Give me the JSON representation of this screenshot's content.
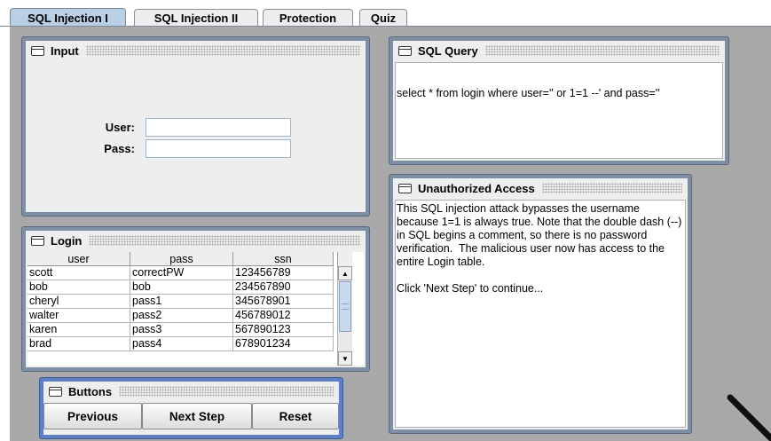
{
  "tabs": [
    {
      "label": "SQL Injection I",
      "active": true
    },
    {
      "label": "SQL Injection II",
      "active": false
    },
    {
      "label": "Protection",
      "active": false
    },
    {
      "label": "Quiz",
      "active": false
    }
  ],
  "input_frame": {
    "title": "Input",
    "user_label": "User:",
    "pass_label": "Pass:",
    "user_value": "",
    "pass_value": ""
  },
  "login_frame": {
    "title": "Login",
    "columns": [
      "user",
      "pass",
      "ssn"
    ],
    "rows": [
      [
        "scott",
        "correctPW",
        "123456789"
      ],
      [
        "bob",
        "bob",
        "234567890"
      ],
      [
        "cheryl",
        "pass1",
        "345678901"
      ],
      [
        "walter",
        "pass2",
        "456789012"
      ],
      [
        "karen",
        "pass3",
        "567890123"
      ],
      [
        "brad",
        "pass4",
        "678901234"
      ]
    ]
  },
  "buttons_frame": {
    "title": "Buttons",
    "previous": "Previous",
    "next": "Next Step",
    "reset": "Reset"
  },
  "query_frame": {
    "title": "SQL Query",
    "text": "select * from login where user='' or 1=1 --' and pass=''"
  },
  "access_frame": {
    "title": "Unauthorized Access",
    "text": "This SQL injection attack bypasses the username because 1=1 is always true. Note that the double dash (--) in SQL begins a comment, so there is no password verification.  The malicious user now has access to the entire Login table.\n\nClick 'Next Step' to continue..."
  },
  "colors": {
    "active_tab": "#b8cfe5",
    "frame_border": "#7e8fa3",
    "buttons_frame_border": "#5e7fc0",
    "desktop": "#a9a9a9"
  }
}
